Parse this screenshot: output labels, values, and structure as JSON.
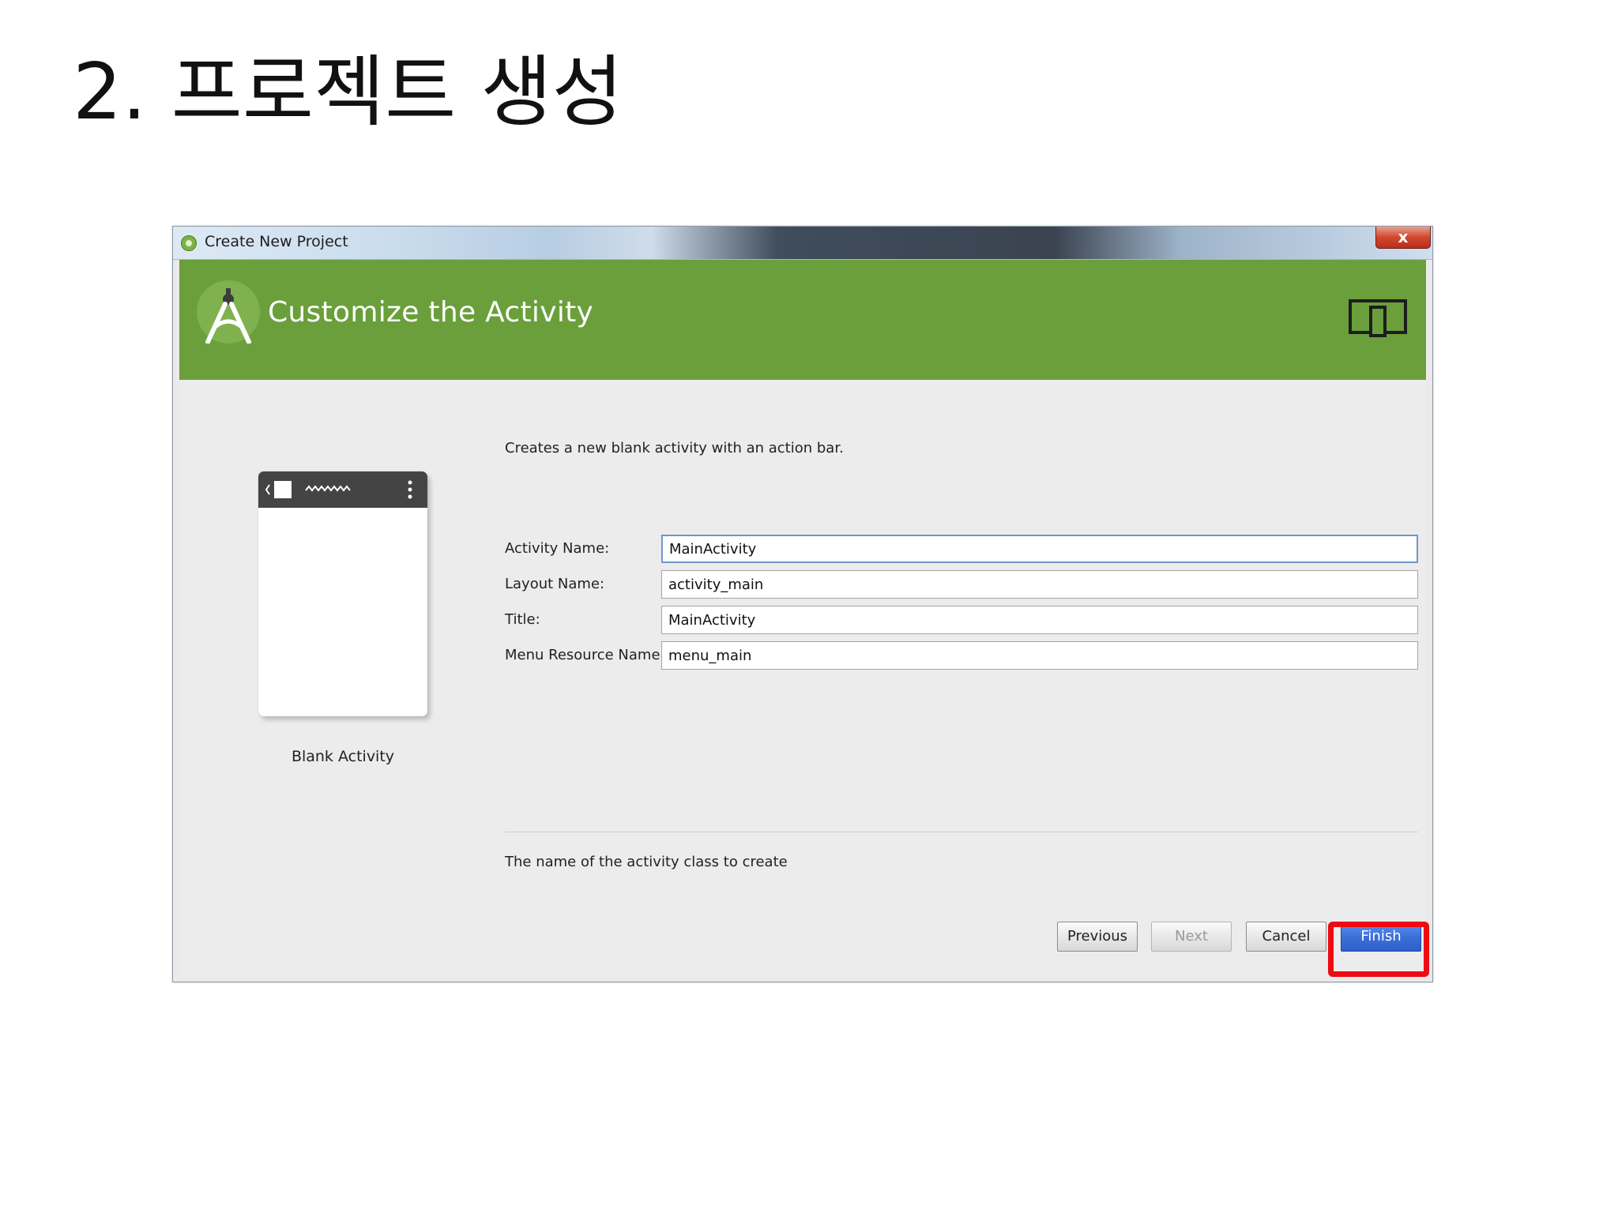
{
  "slide": {
    "title": "2. 프로젝트 생성"
  },
  "window": {
    "title": "Create New Project",
    "close_glyph": "x"
  },
  "header": {
    "title": "Customize the Activity"
  },
  "template": {
    "caption": "Blank Activity"
  },
  "description": "Creates a new blank activity with an action bar.",
  "form": {
    "fields": [
      {
        "label": "Activity Name:",
        "value": "MainActivity"
      },
      {
        "label": "Layout Name:",
        "value": "activity_main"
      },
      {
        "label": "Title:",
        "value": "MainActivity"
      },
      {
        "label": "Menu Resource Name:",
        "value": "menu_main"
      }
    ]
  },
  "help_text": "The name of the activity class to create",
  "buttons": {
    "previous": "Previous",
    "next": "Next",
    "cancel": "Cancel",
    "finish": "Finish"
  },
  "colors": {
    "header_green": "#6a9f3b",
    "highlight_red": "#ee0a12",
    "primary_blue": "#3a6ed8"
  },
  "icons": {
    "app": "android-studio-icon",
    "logo": "android-studio-logo-icon",
    "device": "phone-tablet-icon",
    "close": "close-icon"
  }
}
